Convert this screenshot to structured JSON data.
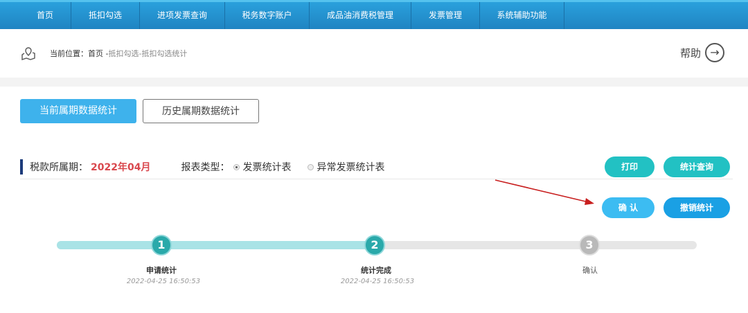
{
  "nav": [
    "首页",
    "抵扣勾选",
    "进项发票查询",
    "税务数字账户",
    "成品油消费税管理",
    "发票管理",
    "系统辅助功能"
  ],
  "breadcrumb": {
    "current_label": "当前位置：首页 - ",
    "path": "抵扣勾选-抵扣勾选统计"
  },
  "help": {
    "label": "帮助",
    "icon": "arrow-right-circle-icon"
  },
  "tabs": {
    "current": "当前属期数据统计",
    "history": "历史属期数据统计"
  },
  "info": {
    "period_label": "税款所属期：",
    "period_value": "2022年04月",
    "report_type_label": "报表类型：",
    "option_invoice": "发票统计表",
    "option_abnormal": "异常发票统计表",
    "selected": "发票统计表"
  },
  "buttons": {
    "print": "打印",
    "query": "统计查询",
    "confirm": "确 认",
    "revoke": "撤销统计"
  },
  "colors": {
    "nav": "#1f84c2",
    "teal": "#22c1c3",
    "blue": "#3eb2ec",
    "red": "#d9484e"
  },
  "steps": [
    {
      "num": "1",
      "label": "申请统计",
      "time": "2022-04-25 16:50:53"
    },
    {
      "num": "2",
      "label": "统计完成",
      "time": "2022-04-25 16:50:53"
    },
    {
      "num": "3",
      "label": "确认",
      "time": ""
    }
  ],
  "progress_completed_steps": 2
}
